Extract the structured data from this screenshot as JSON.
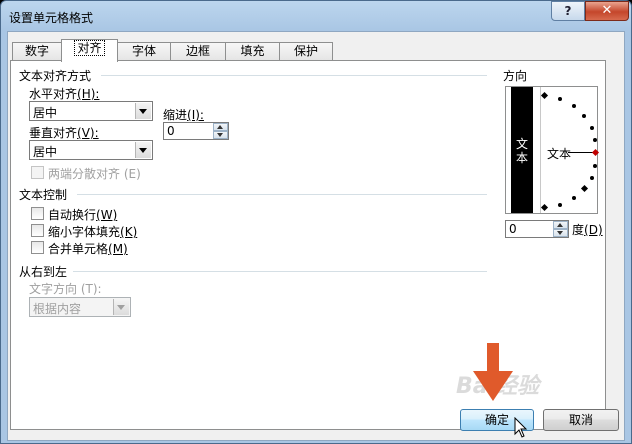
{
  "window": {
    "title": "设置单元格格式",
    "help_label": "?",
    "close_label": "✕"
  },
  "tabs": [
    {
      "label": "数字"
    },
    {
      "label": "对齐"
    },
    {
      "label": "字体"
    },
    {
      "label": "边框"
    },
    {
      "label": "填充"
    },
    {
      "label": "保护"
    }
  ],
  "alignment": {
    "group_title": "文本对齐方式",
    "horizontal_label": "水平对齐",
    "horizontal_key": "(H):",
    "horizontal_value": "居中",
    "indent_label": "缩进",
    "indent_key": "(I):",
    "indent_value": "0",
    "vertical_label": "垂直对齐",
    "vertical_key": "(V):",
    "vertical_value": "居中",
    "distributed_label": "两端分散对齐 (E)"
  },
  "text_control": {
    "group_title": "文本控制",
    "wrap_label": "自动换行",
    "wrap_key": "(W)",
    "shrink_label": "缩小字体填充",
    "shrink_key": "(K)",
    "merge_label": "合并单元格",
    "merge_key": "(M)"
  },
  "rtl": {
    "group_title": "从右到左",
    "direction_label": "文字方向 (T):",
    "direction_value": "根据内容"
  },
  "orientation": {
    "group_title": "方向",
    "vertical_text": "文本",
    "horizontal_text": "文本",
    "degree_value": "0",
    "degree_label": "度",
    "degree_key": "(D)"
  },
  "buttons": {
    "ok_label": "确定",
    "cancel_label": "取消"
  },
  "watermark": {
    "text": "Bai经验"
  },
  "colors": {
    "accent_red": "#e05a2b",
    "orientation_marker": "#c00000"
  }
}
